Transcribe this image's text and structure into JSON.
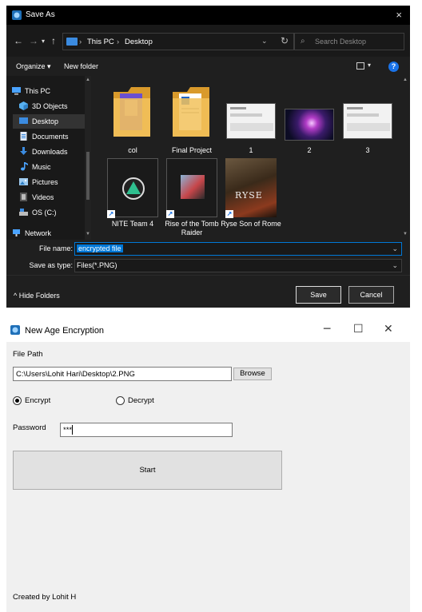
{
  "save_dialog": {
    "title": "Save As",
    "close": "×",
    "breadcrumb": [
      "This PC",
      "Desktop"
    ],
    "breadcrumb_sep": "›",
    "search_placeholder": "Search Desktop",
    "toolbar": {
      "organize": "Organize ▾",
      "new_folder": "New folder",
      "help": "?"
    },
    "nav_items": [
      {
        "label": "This PC",
        "icon": "computer-icon"
      },
      {
        "label": "3D Objects",
        "icon": "cube-icon"
      },
      {
        "label": "Desktop",
        "icon": "desktop-icon",
        "selected": true
      },
      {
        "label": "Documents",
        "icon": "document-icon"
      },
      {
        "label": "Downloads",
        "icon": "download-icon"
      },
      {
        "label": "Music",
        "icon": "music-icon"
      },
      {
        "label": "Pictures",
        "icon": "picture-icon"
      },
      {
        "label": "Videos",
        "icon": "video-icon"
      },
      {
        "label": "OS (C:)",
        "icon": "drive-icon"
      },
      {
        "label": "Network",
        "icon": "network-icon"
      }
    ],
    "files": [
      {
        "name": "col",
        "kind": "folder"
      },
      {
        "name": "Final Project",
        "kind": "folder"
      },
      {
        "name": "1",
        "kind": "image"
      },
      {
        "name": "2",
        "kind": "image"
      },
      {
        "name": "3",
        "kind": "image"
      },
      {
        "name": "NITE Team 4",
        "kind": "shortcut"
      },
      {
        "name": "Rise of the Tomb Raider",
        "kind": "shortcut"
      },
      {
        "name": "Ryse Son of Rome",
        "kind": "shortcut"
      }
    ],
    "file_name_label": "File name:",
    "file_name_value": "encrypted file",
    "save_as_type_label": "Save as type:",
    "save_as_type_value": "Files(*.PNG)",
    "hide_folders": "Hide Folders",
    "save_button": "Save",
    "cancel_button": "Cancel",
    "colors": {
      "background": "#1f1f1f",
      "accent": "#0078d7",
      "folder": "#e8b54a"
    }
  },
  "app_window": {
    "title": "New Age Encryption",
    "controls": {
      "minimize": "─",
      "maximize": "☐",
      "close": "✕"
    },
    "file_path_label": "File Path",
    "file_path_value": "C:\\Users\\Lohit Hari\\Desktop\\2.PNG",
    "browse_button": "Browse",
    "encrypt_label": "Encrypt",
    "decrypt_label": "Decrypt",
    "selected_mode": "Encrypt",
    "password_label": "Password",
    "password_value": "***",
    "start_button": "Start",
    "footer": "Created by Lohit H"
  }
}
